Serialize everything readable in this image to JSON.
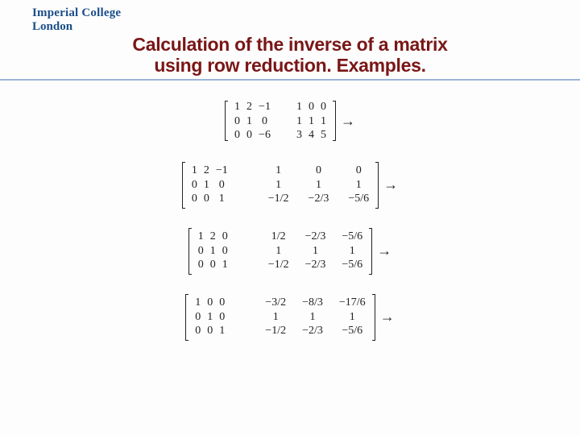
{
  "logo": {
    "line1": "Imperial College",
    "line2": "London"
  },
  "title": {
    "line1": "Calculation of the inverse of a matrix",
    "line2": "using row reduction. Examples."
  },
  "arrow": "→",
  "m1": {
    "L": [
      [
        "1",
        "2",
        "−1"
      ],
      [
        "0",
        "1",
        "0"
      ],
      [
        "0",
        "0",
        "−6"
      ]
    ],
    "R": [
      [
        "1",
        "0",
        "0"
      ],
      [
        "1",
        "1",
        "1"
      ],
      [
        "3",
        "4",
        "5"
      ]
    ]
  },
  "m2": {
    "L": [
      [
        "1",
        "2",
        "−1"
      ],
      [
        "0",
        "1",
        "0"
      ],
      [
        "0",
        "0",
        "1"
      ]
    ],
    "R": [
      [
        "1",
        "0",
        "0"
      ],
      [
        "1",
        "1",
        "1"
      ],
      [
        "−1/2",
        "−2/3",
        "−5/6"
      ]
    ]
  },
  "m3": {
    "L": [
      [
        "1",
        "2",
        "0"
      ],
      [
        "0",
        "1",
        "0"
      ],
      [
        "0",
        "0",
        "1"
      ]
    ],
    "R": [
      [
        "1/2",
        "−2/3",
        "−5/6"
      ],
      [
        "1",
        "1",
        "1"
      ],
      [
        "−1/2",
        "−2/3",
        "−5/6"
      ]
    ]
  },
  "m4": {
    "L": [
      [
        "1",
        "0",
        "0"
      ],
      [
        "0",
        "1",
        "0"
      ],
      [
        "0",
        "0",
        "1"
      ]
    ],
    "R": [
      [
        "−3/2",
        "−8/3",
        "−17/6"
      ],
      [
        "1",
        "1",
        "1"
      ],
      [
        "−1/2",
        "−2/3",
        "−5/6"
      ]
    ]
  }
}
